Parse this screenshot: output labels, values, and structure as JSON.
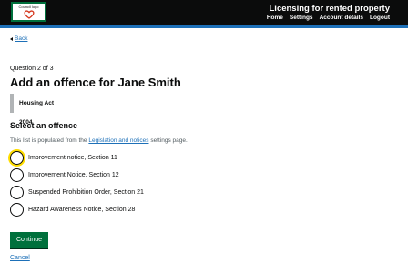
{
  "header": {
    "logo_text": "Council logo",
    "service_name": "Licensing for rented property",
    "nav": [
      "Home",
      "Settings",
      "Account details",
      "Logout"
    ],
    "colors": {
      "background": "#0b0c0c",
      "accent": "#1d70b8"
    }
  },
  "back_link": "Back",
  "question": {
    "caption": "Question 2 of 3",
    "title": "Add an offence for Jane Smith",
    "inset": "Housing Act 2004"
  },
  "form": {
    "legend": "Select an offence",
    "hint_prefix": "This list is populated from the",
    "hint_link": "Legislation and notices",
    "hint_suffix": "settings page.",
    "options": [
      "Improvement notice, Section 11",
      "Improvement Notice, Section 12",
      "Suspended Prohibition Order, Section 21",
      "Hazard Awareness Notice, Section 28"
    ],
    "focused_option": 0,
    "submit_label": "Continue",
    "cancel_label": "Cancel",
    "colors": {
      "submit": "#00703c",
      "link": "#1d70b8",
      "focus": "#ffdd00"
    }
  }
}
